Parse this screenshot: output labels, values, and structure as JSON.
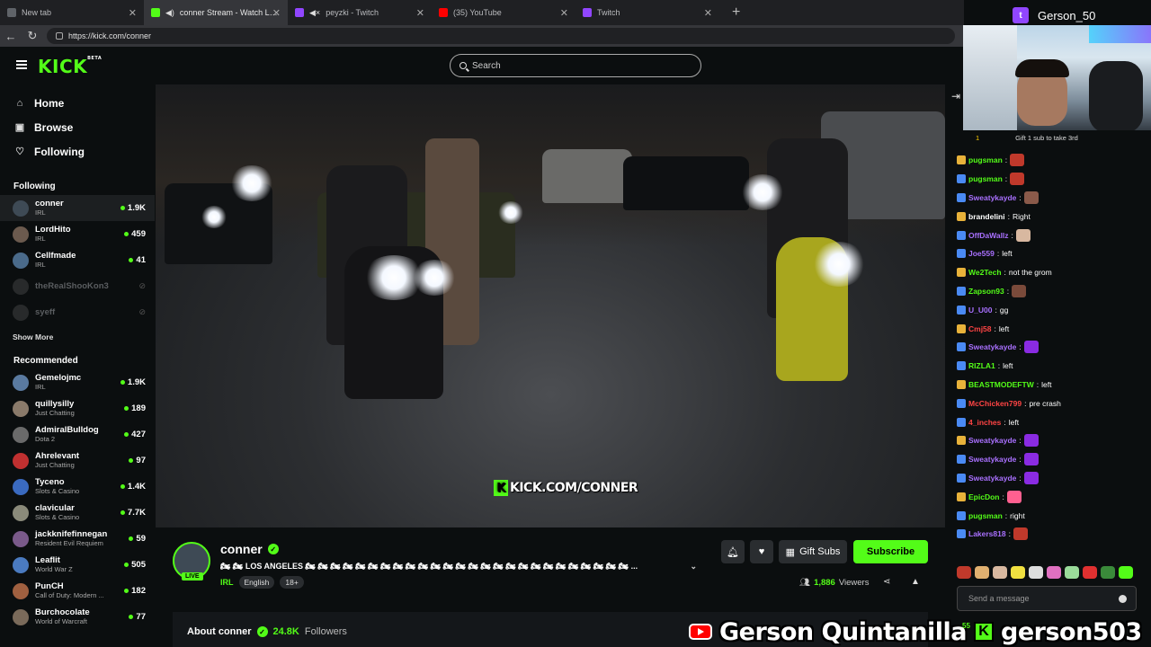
{
  "browser": {
    "tabs": [
      {
        "title": "New tab",
        "color": "#5f6368",
        "active": false
      },
      {
        "title": "conner Stream - Watch Live on Kick",
        "color": "#53fc18",
        "active": true
      },
      {
        "title": "peyzki - Twitch",
        "color": "#9146ff",
        "active": false
      },
      {
        "title": "(35) YouTube",
        "color": "#ff0000",
        "active": false
      },
      {
        "title": "Twitch",
        "color": "#9146ff",
        "active": false
      }
    ],
    "url": "https://kick.com/conner"
  },
  "header": {
    "logo": "KICK",
    "logo_sup": "BETA",
    "search_placeholder": "Search"
  },
  "nav": [
    {
      "label": "Home",
      "icon": "home-icon",
      "glyph": "⌂"
    },
    {
      "label": "Browse",
      "icon": "browse-icon",
      "glyph": "▣"
    },
    {
      "label": "Following",
      "icon": "heart-icon",
      "glyph": "♡"
    }
  ],
  "following": {
    "title": "Following",
    "channels": [
      {
        "name": "conner",
        "category": "IRL",
        "viewers": "1.9K",
        "color": "#3e4a55"
      },
      {
        "name": "LordHito",
        "category": "IRL",
        "viewers": "459",
        "color": "#6b5a4e"
      },
      {
        "name": "Cellfmade",
        "category": "IRL",
        "viewers": "41",
        "color": "#4a6a8a"
      },
      {
        "name": "theRealShooKon3",
        "offline": true,
        "color": "#555"
      },
      {
        "name": "syeff",
        "offline": true,
        "color": "#555"
      }
    ],
    "show_more": "Show More"
  },
  "recommended": {
    "title": "Recommended",
    "channels": [
      {
        "name": "Gemelojmc",
        "category": "IRL",
        "viewers": "1.9K",
        "color": "#5a7aa0"
      },
      {
        "name": "quillysilly",
        "category": "Just Chatting",
        "viewers": "189",
        "color": "#8a7a6a"
      },
      {
        "name": "AdmiralBulldog",
        "category": "Dota 2",
        "viewers": "427",
        "color": "#6a6a6a"
      },
      {
        "name": "Ahrelevant",
        "category": "Just Chatting",
        "viewers": "97",
        "color": "#c03030"
      },
      {
        "name": "Tyceno",
        "category": "Slots & Casino",
        "viewers": "1.4K",
        "color": "#3a6ac0"
      },
      {
        "name": "clavicular",
        "category": "Slots & Casino",
        "viewers": "7.7K",
        "color": "#8a8a7a"
      },
      {
        "name": "jackknifefinnegan",
        "category": "Resident Evil Requiem",
        "viewers": "59",
        "color": "#7a5a8a"
      },
      {
        "name": "Leaflit",
        "category": "World War Z",
        "viewers": "505",
        "color": "#4a7ac0"
      },
      {
        "name": "PunCH",
        "category": "Call of Duty: Modern ...",
        "viewers": "182",
        "color": "#a06040"
      },
      {
        "name": "Burchocolate",
        "category": "World of Warcraft",
        "viewers": "77",
        "color": "#7a6a5a"
      }
    ]
  },
  "video": {
    "watermark_text": "KICK.COM/CONNER",
    "watermark_k": "K"
  },
  "stream": {
    "name": "conner",
    "live": "LIVE",
    "title": "🏍 🏍 LOS ANGELES 🏍 🏍 🏍 🏍 🏍 🏍 🏍 🏍 🏍 🏍 🏍 🏍 🏍 🏍 🏍 🏍 🏍 🏍 🏍 🏍 🏍 🏍 🏍 🏍 🏍 🏍 ...",
    "category": "IRL",
    "tags": [
      "English",
      "18+"
    ],
    "gift_label": "Gift Subs",
    "subscribe_label": "Subscribe",
    "viewers": "1,886",
    "viewers_label": "Viewers",
    "about_label": "About conner",
    "followers": "24.8K",
    "followers_label": "Followers"
  },
  "chat": {
    "messages": [
      {
        "user": "pugsman",
        "color": "#53fc18",
        "text": "",
        "emote": "#c0392b"
      },
      {
        "user": "pugsman",
        "color": "#53fc18",
        "text": "",
        "emote": "#c0392b"
      },
      {
        "user": "Sweatykayde",
        "color": "#a970ff",
        "text": "",
        "emote": "#8a5a4a"
      },
      {
        "user": "brandelini",
        "color": "#ffffff",
        "text": "Right",
        "emote": ""
      },
      {
        "user": "OffDaWallz",
        "color": "#a970ff",
        "text": "",
        "emote": "#d8b8a0"
      },
      {
        "user": "Joe559",
        "color": "#a970ff",
        "text": "left",
        "emote": ""
      },
      {
        "user": "We2Tech",
        "color": "#53fc18",
        "text": "not the grom",
        "emote": ""
      },
      {
        "user": "Zapson93",
        "color": "#53fc18",
        "text": "",
        "emote": "#7a4a3a"
      },
      {
        "user": "U_U00",
        "color": "#a970ff",
        "text": "gg",
        "emote": ""
      },
      {
        "user": "Cmj58",
        "color": "#ff4444",
        "text": "left",
        "emote": ""
      },
      {
        "user": "Sweatykayde",
        "color": "#a970ff",
        "text": "",
        "emote": "#8a2be2"
      },
      {
        "user": "RIZLA1",
        "color": "#53fc18",
        "text": "left",
        "emote": ""
      },
      {
        "user": "BEASTMODEFTW",
        "color": "#53fc18",
        "text": "left",
        "emote": ""
      },
      {
        "user": "McChicken799",
        "color": "#ff4444",
        "text": "pre crash",
        "emote": ""
      },
      {
        "user": "4_inches",
        "color": "#ff4444",
        "text": "left",
        "emote": ""
      },
      {
        "user": "Sweatykayde",
        "color": "#a970ff",
        "text": "",
        "emote": "#8a2be2"
      },
      {
        "user": "Sweatykayde",
        "color": "#a970ff",
        "text": "",
        "emote": "#8a2be2"
      },
      {
        "user": "Sweatykayde",
        "color": "#a970ff",
        "text": "",
        "emote": "#8a2be2"
      },
      {
        "user": "EpicDon",
        "color": "#53fc18",
        "text": "",
        "emote": "#ff6090"
      },
      {
        "user": "pugsman",
        "color": "#53fc18",
        "text": "right",
        "emote": ""
      },
      {
        "user": "Lakers818",
        "color": "#a970ff",
        "text": "",
        "emote": "#c0392b"
      }
    ],
    "input_placeholder": "Send a message"
  },
  "webcam": {
    "platform": "twitch",
    "username": "Gerson_50",
    "gift_count": "1",
    "gift_text": "Gift 1 sub to take 3rd"
  },
  "overlay": {
    "youtube_name": "Gerson Quintanilla",
    "kick_name": "gerson503",
    "viewer_count": "55"
  }
}
